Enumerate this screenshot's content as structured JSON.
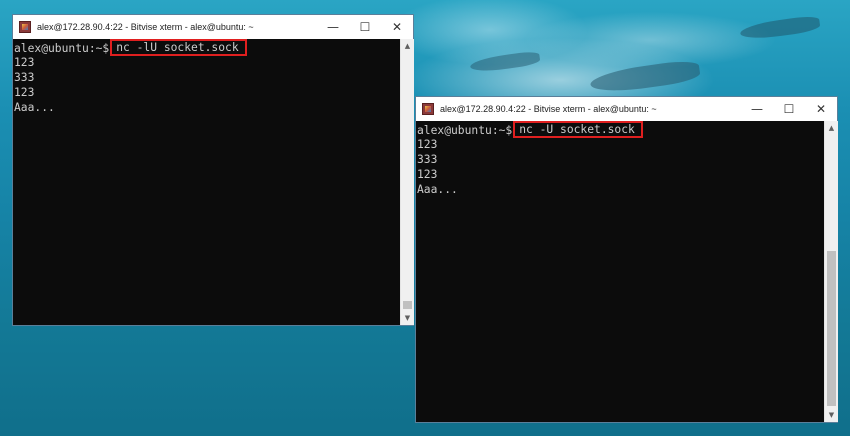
{
  "windows": [
    {
      "title": "alex@172.28.90.4:22 - Bitvise xterm - alex@ubuntu: ~",
      "prompt": "alex@ubuntu:~$",
      "command": "nc -lU socket.sock",
      "output": [
        "123",
        "333",
        "123",
        "Aaa..."
      ]
    },
    {
      "title": "alex@172.28.90.4:22 - Bitvise xterm - alex@ubuntu: ~",
      "prompt": "alex@ubuntu:~$",
      "command": "nc -U socket.sock",
      "output": [
        "123",
        "333",
        "123",
        "Aaa..."
      ]
    }
  ],
  "controls": {
    "minimize": "—",
    "maximize": "☐",
    "close": "✕"
  },
  "icons": {
    "app": "bitvise-xterm-icon",
    "scroll_up": "▲",
    "scroll_down": "▼"
  },
  "colors": {
    "highlight": "#e01f1f",
    "terminal_bg": "#0c0c0c",
    "terminal_fg": "#cccccc"
  }
}
